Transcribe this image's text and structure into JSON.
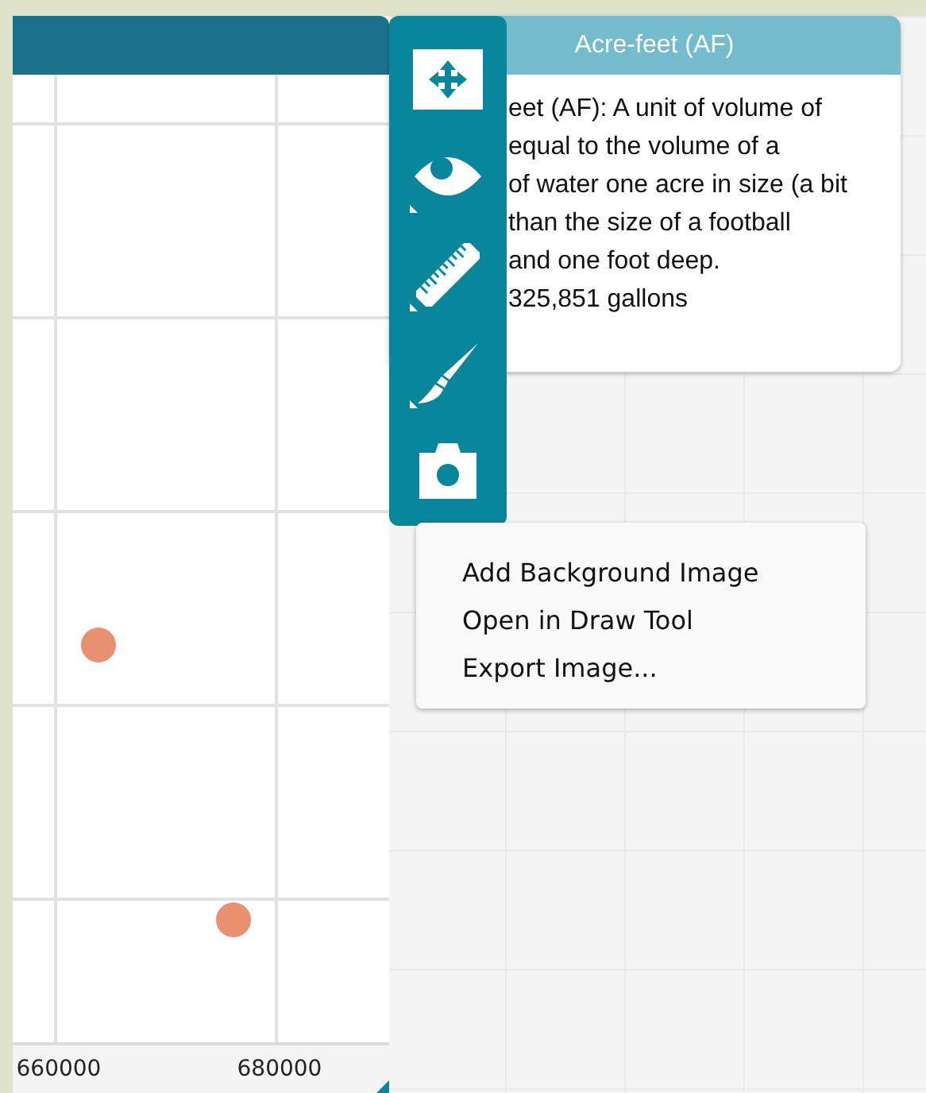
{
  "plot": {
    "x_tick_labels": [
      "660000",
      "680000"
    ]
  },
  "toolbar": {
    "tools": [
      {
        "kind": "move",
        "has_submenu": false
      },
      {
        "kind": "eye",
        "has_submenu": true
      },
      {
        "kind": "ruler",
        "has_submenu": true
      },
      {
        "kind": "brush",
        "has_submenu": true
      },
      {
        "kind": "camera",
        "has_submenu": false
      }
    ]
  },
  "info_card": {
    "title": "Acre-feet (AF)",
    "lines": [
      "eet (AF): A unit of volume of",
      "equal to the volume of a",
      "of water one acre in size (a bit",
      "than the size of a football",
      "and one foot deep.",
      "325,851 gallons"
    ]
  },
  "context_menu": {
    "items": [
      "Add Background Image",
      "Open in Draw Tool",
      "Export Image..."
    ]
  }
}
